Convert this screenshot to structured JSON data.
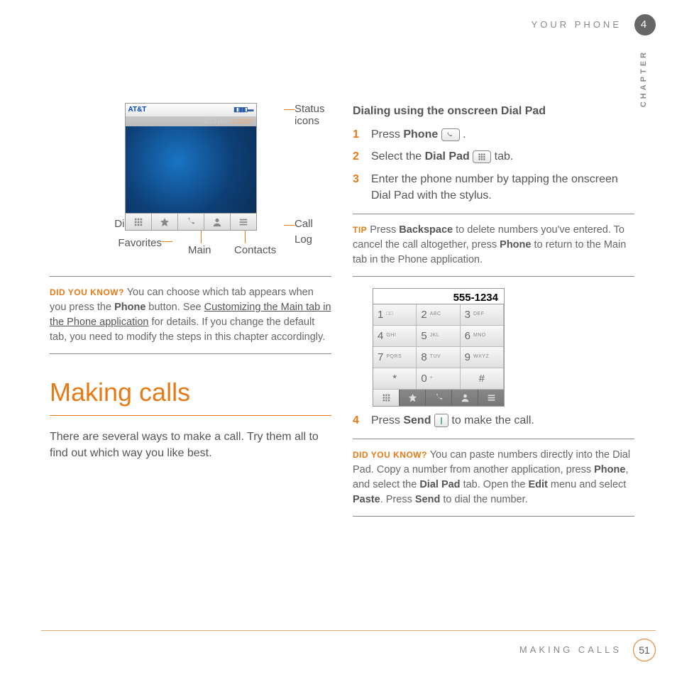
{
  "header": {
    "section_top": "YOUR PHONE",
    "chapter_num": "4",
    "chapter_label": "CHAPTER"
  },
  "phone_mock": {
    "carrier": "AT&T",
    "time": "4:19 pm",
    "date": "1/22/07",
    "tabs": [
      "dial-pad",
      "favorites",
      "main",
      "contacts",
      "call-log"
    ]
  },
  "annotations": {
    "status": "Status icons",
    "dial_pad": "Dial Pad",
    "favorites": "Favorites",
    "main": "Main",
    "contacts": "Contacts",
    "call_log": "Call Log"
  },
  "dyk1": {
    "lead": "DID YOU KNOW?",
    "text_a": " You can choose which tab appears when you press the ",
    "b1": "Phone",
    "text_b": " button. See ",
    "link": "Customizing the Main tab in the Phone application",
    "text_c": " for details. If you change the default tab, you need to modify the steps in this chapter accordingly."
  },
  "section_title": "Making calls",
  "intro": "There are several ways to make a call. Try them all to find out which way you like best.",
  "subhead": "Dialing using the onscreen Dial Pad",
  "steps": {
    "s1a": "Press ",
    "s1b": "Phone",
    "s1c": ".",
    "s2a": "Select the ",
    "s2b": "Dial Pad",
    "s2c": " tab.",
    "s3": "Enter the phone number by tapping the onscreen Dial Pad with the stylus.",
    "s4a": "Press ",
    "s4b": "Send",
    "s4c": " to make the call."
  },
  "tip": {
    "lead": "TIP",
    "text_a": " Press ",
    "b1": "Backspace",
    "text_b": " to delete numbers you've entered. To cancel the call altogether, press ",
    "b2": "Phone",
    "text_c": " to return to the Main tab in the Phone application."
  },
  "dialpad": {
    "display": "555-1234",
    "keys": [
      {
        "n": "1",
        "s": "□□"
      },
      {
        "n": "2",
        "s": "ABC"
      },
      {
        "n": "3",
        "s": "DEF"
      },
      {
        "n": "4",
        "s": "GHI"
      },
      {
        "n": "5",
        "s": "JKL"
      },
      {
        "n": "6",
        "s": "MNO"
      },
      {
        "n": "7",
        "s": "PQRS"
      },
      {
        "n": "8",
        "s": "TUV"
      },
      {
        "n": "9",
        "s": "WXYZ"
      },
      {
        "n": "*",
        "s": ""
      },
      {
        "n": "0",
        "s": "+"
      },
      {
        "n": "#",
        "s": ""
      }
    ]
  },
  "dyk2": {
    "lead": "DID YOU KNOW?",
    "text_a": " You can paste numbers directly into the Dial Pad. Copy a number from another application, press ",
    "b1": "Phone",
    "text_b": ", and select the ",
    "b2": "Dial Pad",
    "text_c": " tab. Open the ",
    "b3": "Edit",
    "text_d": " menu and select ",
    "b4": "Paste",
    "text_e": ". Press ",
    "b5": "Send",
    "text_f": " to dial the number."
  },
  "footer": {
    "text": "MAKING CALLS",
    "page": "51"
  }
}
